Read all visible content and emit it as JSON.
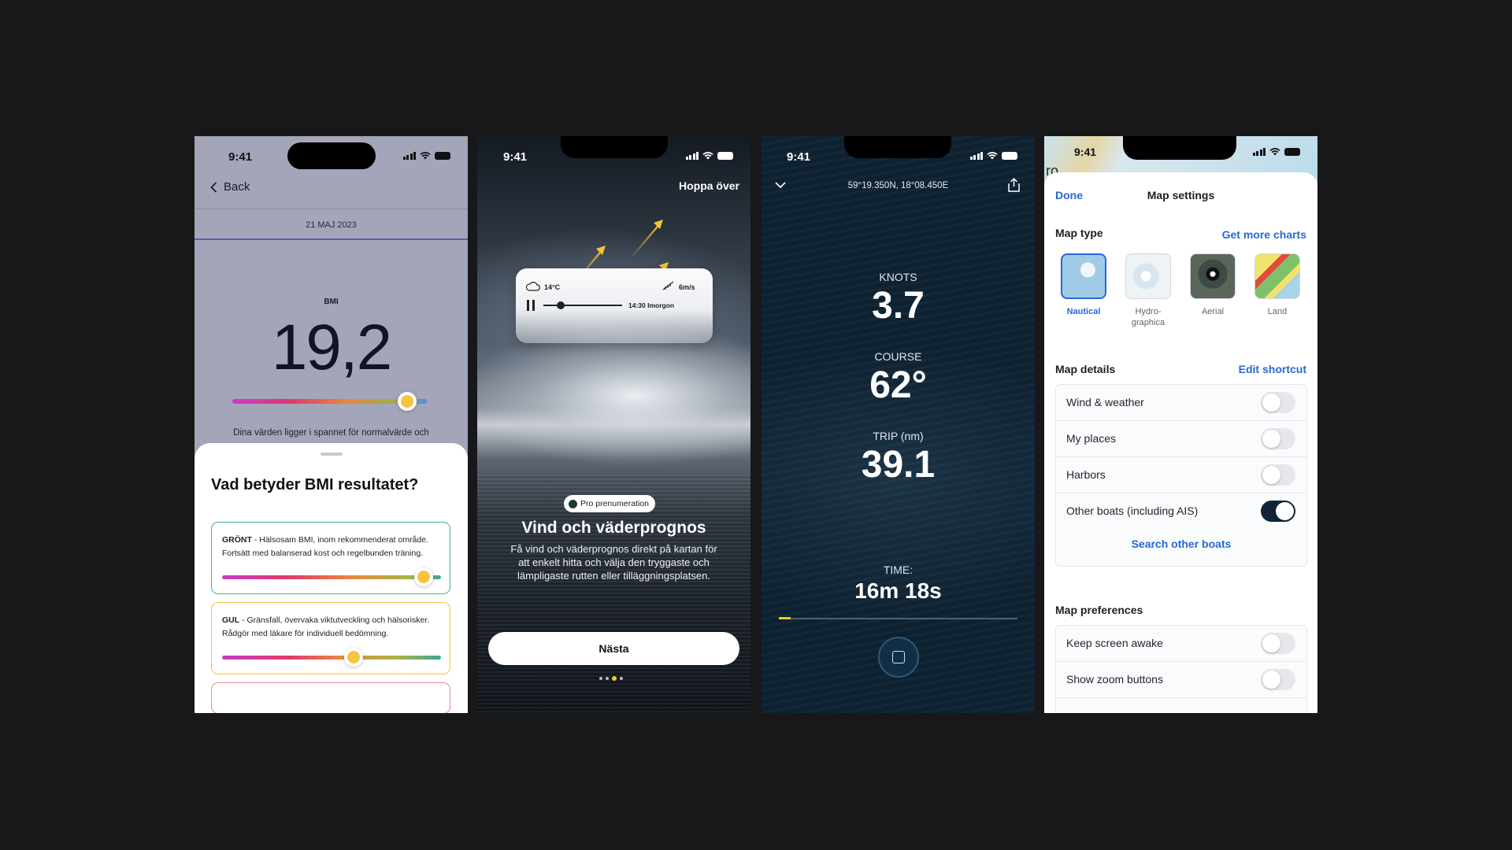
{
  "status": {
    "time": "9:41"
  },
  "bmi_screen": {
    "back_label": "Back",
    "date": "21 MAJ 2023",
    "metric_label": "BMI",
    "metric_value": "19,2",
    "gauge_level_pct": 90,
    "description": "Dina värden ligger i spannet för normalvärde och",
    "sheet": {
      "title": "Vad betyder BMI resultatet?",
      "cards": [
        {
          "key": "GRÖNT",
          "text": " - Hälsosam BMI, inom rekommenderat område. Fortsätt med balanserad kost och regelbunden träning.",
          "border": "#3db08e",
          "level_pct": 92
        },
        {
          "key": "GUL",
          "text": " - Gränsfall, övervaka viktutveckling och hälsorisker. Rådgör med läkare för individuell bedömning.",
          "border": "#f1c24a",
          "level_pct": 60
        }
      ]
    }
  },
  "onboarding_screen": {
    "skip_label": "Hoppa över",
    "weather_card": {
      "temperature": "14°C",
      "wind": "6m/s",
      "time_label": "14:30 Imorgon"
    },
    "badge": "Pro prenumeration",
    "title": "Vind och väderprognos",
    "body": "Få vind och väderprognos direkt på kartan för att enkelt hitta och välja den tryggaste och lämpligaste rutten eller tilläggningsplatsen.",
    "next_button": "Nästa",
    "page_count": 4,
    "page_active": 3
  },
  "trip_screen": {
    "coordinates": "59°19.350N, 18°08.450E",
    "speed_label": "KNOTS",
    "speed_value": "3.7",
    "course_label": "COURSE",
    "course_value": "62°",
    "trip_label": "TRIP (nm)",
    "trip_value": "39.1",
    "time_label": "TIME:",
    "time_value": "16m 18s",
    "progress_pct": 5
  },
  "map_settings_screen": {
    "done_label": "Done",
    "title": "Map settings",
    "map_type": {
      "heading": "Map type",
      "link": "Get more charts",
      "options": [
        {
          "label": "Nautical",
          "selected": true
        },
        {
          "label": "Hydro-graphica",
          "line1": "Hydro-",
          "line2": "graphica",
          "selected": false
        },
        {
          "label": "Aerial",
          "selected": false
        },
        {
          "label": "Land",
          "selected": false
        }
      ]
    },
    "map_details": {
      "heading": "Map details",
      "link": "Edit shortcut",
      "rows": [
        {
          "label": "Wind & weather",
          "on": false
        },
        {
          "label": "My places",
          "on": false
        },
        {
          "label": "Harbors",
          "on": false
        },
        {
          "label": "Other boats (including AIS)",
          "on": true
        }
      ],
      "search_link": "Search other boats"
    },
    "map_preferences": {
      "heading": "Map preferences",
      "rows": [
        {
          "label": "Keep screen awake",
          "on": false
        },
        {
          "label": "Show zoom buttons",
          "on": false
        }
      ]
    },
    "map_fragment_text": "ro"
  },
  "colors": {
    "accent_blue": "#2768d6",
    "accent_yellow": "#f4c732",
    "toggle_on": "#0f2438"
  }
}
